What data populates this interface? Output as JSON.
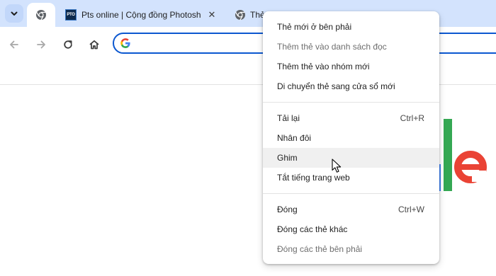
{
  "tabs": [
    {
      "title": "",
      "icon": "chrome-icon",
      "active": true
    },
    {
      "title": "Pts online | Cộng đồng Photosh",
      "icon": "pts-favicon",
      "favicon_text": "PTO",
      "active": false
    },
    {
      "title": "Thẻ m",
      "icon": "chrome-icon",
      "active": false
    }
  ],
  "omnibox": {
    "value": ""
  },
  "context_menu": {
    "groups": [
      [
        {
          "label": "Thẻ mới ở bên phải",
          "shortcut": "",
          "disabled": false
        },
        {
          "label": "Thêm thẻ vào danh sách đọc",
          "shortcut": "",
          "disabled": true
        },
        {
          "label": "Thêm thẻ vào nhóm mới",
          "shortcut": "",
          "disabled": false
        },
        {
          "label": "Di chuyển thẻ sang cửa sổ mới",
          "shortcut": "",
          "disabled": false
        }
      ],
      [
        {
          "label": "Tải lại",
          "shortcut": "Ctrl+R",
          "disabled": false
        },
        {
          "label": "Nhân đôi",
          "shortcut": "",
          "disabled": false
        },
        {
          "label": "Ghim",
          "shortcut": "",
          "disabled": false,
          "hovered": true
        },
        {
          "label": "Tắt tiếng trang web",
          "shortcut": "",
          "disabled": false
        }
      ],
      [
        {
          "label": "Đóng",
          "shortcut": "Ctrl+W",
          "disabled": false
        },
        {
          "label": "Đóng các thẻ khác",
          "shortcut": "",
          "disabled": false
        },
        {
          "label": "Đóng các thẻ bên phải",
          "shortcut": "",
          "disabled": true
        }
      ]
    ]
  },
  "colors": {
    "tabstrip": "#d3e3fd",
    "omnibox_border": "#0b57d0",
    "google_blue": "#4285f4",
    "google_red": "#ea4335",
    "google_yellow": "#fbbc05",
    "google_green": "#34a853"
  }
}
